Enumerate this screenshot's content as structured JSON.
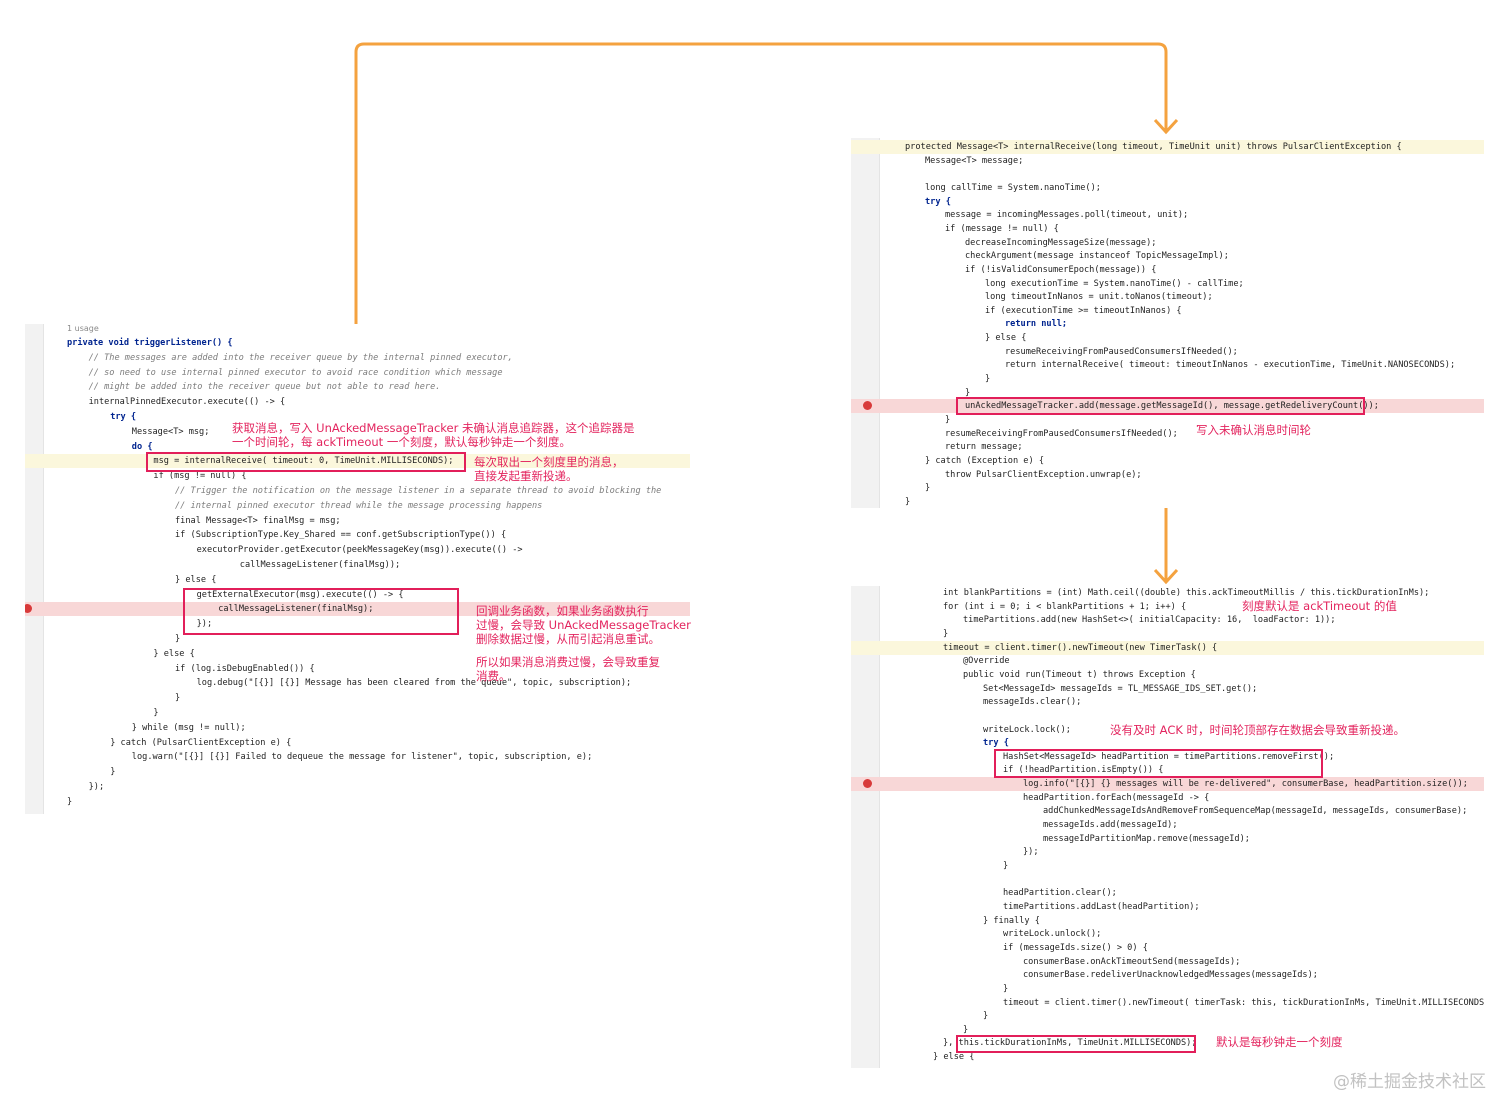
{
  "left_panel": {
    "usage_label": "1 usage",
    "lines": [
      {
        "text": "private void triggerListener() {",
        "indent": 0,
        "style": "kw"
      },
      {
        "text": "// The messages are added into the receiver queue by the internal pinned executor,",
        "indent": 2,
        "style": "cmt"
      },
      {
        "text": "// so need to use internal pinned executor to avoid race condition which message",
        "indent": 2,
        "style": "cmt"
      },
      {
        "text": "// might be added into the receiver queue but not able to read here.",
        "indent": 2,
        "style": "cmt"
      },
      {
        "text": "internalPinnedExecutor.execute(() -> {",
        "indent": 2,
        "style": ""
      },
      {
        "text": "try {",
        "indent": 4,
        "style": "kw"
      },
      {
        "text": "Message<T> msg;",
        "indent": 6,
        "style": ""
      },
      {
        "text": "do {",
        "indent": 6,
        "style": "kw"
      },
      {
        "text": "msg = internalReceive( timeout: 0, TimeUnit.MILLISECONDS);",
        "indent": 8,
        "style": "",
        "highlight": "yel"
      },
      {
        "text": "if (msg != null) {",
        "indent": 8,
        "style": ""
      },
      {
        "text": "// Trigger the notification on the message listener in a separate thread to avoid blocking the",
        "indent": 10,
        "style": "cmt"
      },
      {
        "text": "// internal pinned executor thread while the message processing happens",
        "indent": 10,
        "style": "cmt"
      },
      {
        "text": "final Message<T> finalMsg = msg;",
        "indent": 10,
        "style": ""
      },
      {
        "text": "if (SubscriptionType.Key_Shared == conf.getSubscriptionType()) {",
        "indent": 10,
        "style": ""
      },
      {
        "text": "executorProvider.getExecutor(peekMessageKey(msg)).execute(() ->",
        "indent": 12,
        "style": ""
      },
      {
        "text": "callMessageListener(finalMsg));",
        "indent": 16,
        "style": ""
      },
      {
        "text": "} else {",
        "indent": 10,
        "style": ""
      },
      {
        "text": "getExternalExecutor(msg).execute(() -> {",
        "indent": 12,
        "style": ""
      },
      {
        "text": "callMessageListener(finalMsg);",
        "indent": 14,
        "style": "",
        "highlight": "red",
        "breakpoint": true
      },
      {
        "text": "});",
        "indent": 12,
        "style": ""
      },
      {
        "text": "}",
        "indent": 10,
        "style": ""
      },
      {
        "text": "} else {",
        "indent": 8,
        "style": ""
      },
      {
        "text": "if (log.isDebugEnabled()) {",
        "indent": 10,
        "style": ""
      },
      {
        "text": "log.debug(\"[{}] [{}] Message has been cleared from the queue\", topic, subscription);",
        "indent": 12,
        "style": ""
      },
      {
        "text": "}",
        "indent": 10,
        "style": ""
      },
      {
        "text": "}",
        "indent": 8,
        "style": ""
      },
      {
        "text": "} while (msg != null);",
        "indent": 6,
        "style": ""
      },
      {
        "text": "} catch (PulsarClientException e) {",
        "indent": 4,
        "style": ""
      },
      {
        "text": "log.warn(\"[{}] [{}] Failed to dequeue the message for listener\", topic, subscription, e);",
        "indent": 6,
        "style": ""
      },
      {
        "text": "}",
        "indent": 4,
        "style": ""
      },
      {
        "text": "});",
        "indent": 2,
        "style": ""
      },
      {
        "text": "}",
        "indent": 0,
        "style": ""
      }
    ]
  },
  "top_right_panel": {
    "lines": [
      {
        "text": "protected Message<T> internalReceive(long timeout, TimeUnit unit) throws PulsarClientException {",
        "indent": 0,
        "style": "",
        "highlight": "yel"
      },
      {
        "text": "Message<T> message;",
        "indent": 2,
        "style": ""
      },
      {
        "text": "",
        "indent": 0,
        "style": ""
      },
      {
        "text": "long callTime = System.nanoTime();",
        "indent": 2,
        "style": ""
      },
      {
        "text": "try {",
        "indent": 2,
        "style": "kw"
      },
      {
        "text": "message = incomingMessages.poll(timeout, unit);",
        "indent": 4,
        "style": ""
      },
      {
        "text": "if (message != null) {",
        "indent": 4,
        "style": ""
      },
      {
        "text": "decreaseIncomingMessageSize(message);",
        "indent": 6,
        "style": ""
      },
      {
        "text": "checkArgument(message instanceof TopicMessageImpl);",
        "indent": 6,
        "style": ""
      },
      {
        "text": "if (!isValidConsumerEpoch(message)) {",
        "indent": 6,
        "style": ""
      },
      {
        "text": "long executionTime = System.nanoTime() - callTime;",
        "indent": 8,
        "style": ""
      },
      {
        "text": "long timeoutInNanos = unit.toNanos(timeout);",
        "indent": 8,
        "style": ""
      },
      {
        "text": "if (executionTime >= timeoutInNanos) {",
        "indent": 8,
        "style": ""
      },
      {
        "text": "return null;",
        "indent": 10,
        "style": "kw"
      },
      {
        "text": "} else {",
        "indent": 8,
        "style": ""
      },
      {
        "text": "resumeReceivingFromPausedConsumersIfNeeded();",
        "indent": 10,
        "style": ""
      },
      {
        "text": "return internalReceive( timeout: timeoutInNanos - executionTime, TimeUnit.NANOSECONDS);",
        "indent": 10,
        "style": ""
      },
      {
        "text": "}",
        "indent": 8,
        "style": ""
      },
      {
        "text": "}",
        "indent": 6,
        "style": ""
      },
      {
        "text": "unAckedMessageTracker.add(message.getMessageId(), message.getRedeliveryCount());",
        "indent": 6,
        "style": "",
        "highlight": "red",
        "breakpoint": true
      },
      {
        "text": "}",
        "indent": 4,
        "style": ""
      },
      {
        "text": "resumeReceivingFromPausedConsumersIfNeeded();",
        "indent": 4,
        "style": ""
      },
      {
        "text": "return message;",
        "indent": 4,
        "style": ""
      },
      {
        "text": "} catch (Exception e) {",
        "indent": 2,
        "style": ""
      },
      {
        "text": "throw PulsarClientException.unwrap(e);",
        "indent": 4,
        "style": ""
      },
      {
        "text": "}",
        "indent": 2,
        "style": ""
      },
      {
        "text": "}",
        "indent": 0,
        "style": ""
      }
    ]
  },
  "bottom_right_panel": {
    "lines": [
      {
        "text": "int blankPartitions = (int) Math.ceil((double) this.ackTimeoutMillis / this.tickDurationInMs);",
        "indent": 0,
        "style": ""
      },
      {
        "text": "for (int i = 0; i < blankPartitions + 1; i++) {",
        "indent": 0,
        "style": ""
      },
      {
        "text": "timePartitions.add(new HashSet<>( initialCapacity: 16,  loadFactor: 1));",
        "indent": 2,
        "style": ""
      },
      {
        "text": "}",
        "indent": 0,
        "style": ""
      },
      {
        "text": "timeout = client.timer().newTimeout(new TimerTask() {",
        "indent": 0,
        "style": "",
        "highlight": "yel"
      },
      {
        "text": "@Override",
        "indent": 2,
        "style": ""
      },
      {
        "text": "public void run(Timeout t) throws Exception {",
        "indent": 2,
        "style": ""
      },
      {
        "text": "Set<MessageId> messageIds = TL_MESSAGE_IDS_SET.get();",
        "indent": 4,
        "style": ""
      },
      {
        "text": "messageIds.clear();",
        "indent": 4,
        "style": ""
      },
      {
        "text": "",
        "indent": 0,
        "style": ""
      },
      {
        "text": "writeLock.lock();",
        "indent": 4,
        "style": ""
      },
      {
        "text": "try {",
        "indent": 4,
        "style": "kw"
      },
      {
        "text": "HashSet<MessageId> headPartition = timePartitions.removeFirst();",
        "indent": 6,
        "style": ""
      },
      {
        "text": "if (!headPartition.isEmpty()) {",
        "indent": 6,
        "style": ""
      },
      {
        "text": "log.info(\"[{}] {} messages will be re-delivered\", consumerBase, headPartition.size());",
        "indent": 8,
        "style": "",
        "highlight": "red",
        "breakpoint": true
      },
      {
        "text": "headPartition.forEach(messageId -> {",
        "indent": 8,
        "style": ""
      },
      {
        "text": "addChunkedMessageIdsAndRemoveFromSequenceMap(messageId, messageIds, consumerBase);",
        "indent": 10,
        "style": ""
      },
      {
        "text": "messageIds.add(messageId);",
        "indent": 10,
        "style": ""
      },
      {
        "text": "messageIdPartitionMap.remove(messageId);",
        "indent": 10,
        "style": ""
      },
      {
        "text": "});",
        "indent": 8,
        "style": ""
      },
      {
        "text": "}",
        "indent": 6,
        "style": ""
      },
      {
        "text": "",
        "indent": 0,
        "style": ""
      },
      {
        "text": "headPartition.clear();",
        "indent": 6,
        "style": ""
      },
      {
        "text": "timePartitions.addLast(headPartition);",
        "indent": 6,
        "style": ""
      },
      {
        "text": "} finally {",
        "indent": 4,
        "style": ""
      },
      {
        "text": "writeLock.unlock();",
        "indent": 6,
        "style": ""
      },
      {
        "text": "if (messageIds.size() > 0) {",
        "indent": 6,
        "style": ""
      },
      {
        "text": "consumerBase.onAckTimeoutSend(messageIds);",
        "indent": 8,
        "style": ""
      },
      {
        "text": "consumerBase.redeliverUnacknowledgedMessages(messageIds);",
        "indent": 8,
        "style": ""
      },
      {
        "text": "}",
        "indent": 6,
        "style": ""
      },
      {
        "text": "timeout = client.timer().newTimeout( timerTask: this, tickDurationInMs, TimeUnit.MILLISECONDS);",
        "indent": 6,
        "style": ""
      },
      {
        "text": "}",
        "indent": 4,
        "style": ""
      },
      {
        "text": "}",
        "indent": 2,
        "style": ""
      },
      {
        "text": "}, this.tickDurationInMs, TimeUnit.MILLISECONDS);",
        "indent": 0,
        "style": ""
      },
      {
        "text": "} else {",
        "indent": -1,
        "style": ""
      }
    ]
  },
  "annotations": {
    "receive_note": "获取消息，写入 UnAckedMessageTracker 未确认消息追踪器，这个追踪器是\n一个时间轮，每 ackTimeout 一个刻度，默认每秒钟走一个刻度。",
    "tick_note": "每次取出一个刻度里的消息，\n直接发起重新投递。",
    "callback_note": "回调业务函数，如果业务函数执行\n过慢，会导致 UnAckedMessageTracker\n删除数据过慢，从而引起消息重试。",
    "slow_consume_note": "所以如果消息消费过慢，会导致重复\n消费。",
    "write_wheel_note": "写入未确认消息时间轮",
    "tick_default_note": "刻度默认是 ackTimeout 的值",
    "no_ack_note": "没有及时 ACK 时，时间轮顶部存在数据会导致重新投递。",
    "per_second_note": "默认是每秒钟走一个刻度"
  },
  "watermark": "@稀土掘金技术社区",
  "colors": {
    "arrow": "#f4a23f",
    "annotation": "#e3245e",
    "breakpoint": "#d83a3a",
    "highlight_red": "#f8d7d7",
    "highlight_yellow": "#fbf7dc"
  }
}
